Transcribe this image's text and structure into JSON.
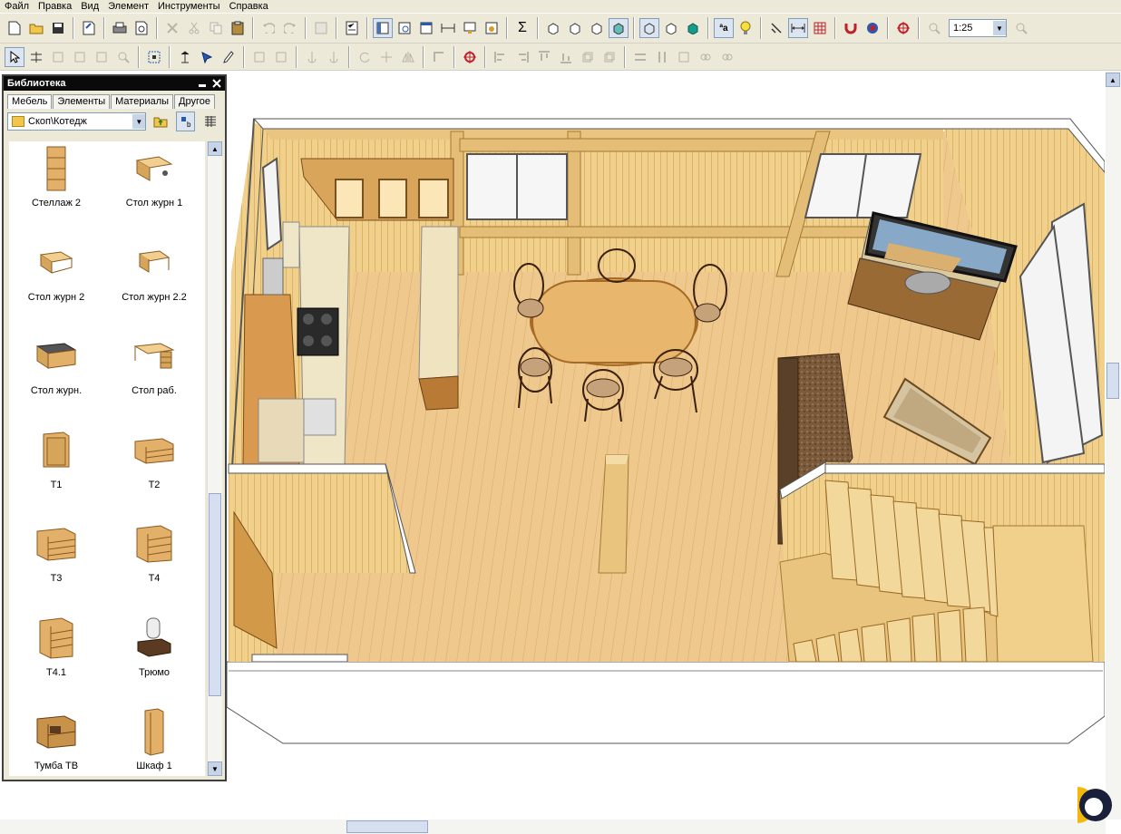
{
  "menu": [
    "Файл",
    "Правка",
    "Вид",
    "Элемент",
    "Инструменты",
    "Справка"
  ],
  "toolbar": {
    "zoom_value": "1:25",
    "sigma": "Σ",
    "font_button": "ªa"
  },
  "library": {
    "title": "Библиотека",
    "tabs": [
      "Мебель",
      "Элементы",
      "Материалы",
      "Другое"
    ],
    "path": "Скоп\\Котедж",
    "items": [
      {
        "label": "Стеллаж 2",
        "icon": "shelf-icon"
      },
      {
        "label": "Стол журн 1",
        "icon": "coffee-table-icon"
      },
      {
        "label": "Стол журн 2",
        "icon": "coffee-table-icon"
      },
      {
        "label": "Стол журн 2.2",
        "icon": "coffee-table-icon"
      },
      {
        "label": "Стол журн.",
        "icon": "glass-table-icon"
      },
      {
        "label": "Стол раб.",
        "icon": "desk-icon"
      },
      {
        "label": "Т1",
        "icon": "cabinet-icon"
      },
      {
        "label": "Т2",
        "icon": "drawers-icon"
      },
      {
        "label": "Т3",
        "icon": "drawers-icon"
      },
      {
        "label": "Т4",
        "icon": "drawers-icon"
      },
      {
        "label": "Т4.1",
        "icon": "drawers-icon"
      },
      {
        "label": "Трюмо",
        "icon": "dresser-mirror-icon"
      },
      {
        "label": "Тумба ТВ",
        "icon": "tv-stand-icon"
      },
      {
        "label": "Шкаф 1",
        "icon": "wardrobe-icon"
      }
    ]
  },
  "colors": {
    "wood": "#e8c47e",
    "wood_dark": "#c9973f",
    "panel_bg": "#ece9d8"
  }
}
